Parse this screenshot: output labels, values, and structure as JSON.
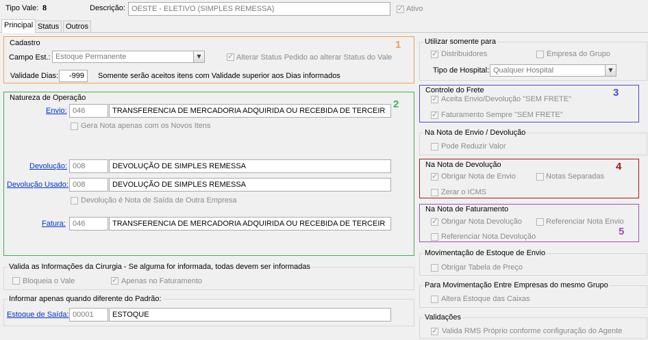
{
  "header": {
    "tipo_vale_label": "Tipo Vale:",
    "tipo_vale_value": "8",
    "descricao_label": "Descrição:",
    "descricao_value": "OESTE - ELETIVO (SIMPLES REMESSA)",
    "ativo_label": "Ativo"
  },
  "tabs": [
    {
      "label": "Principal"
    },
    {
      "label": "Status"
    },
    {
      "label": "Outros"
    }
  ],
  "cadastro": {
    "title": "Cadastro",
    "campo_est_label": "Campo Est.:",
    "campo_est_value": "Estoque Permanente",
    "alterar_status_label": "Alterar Status Pedido ao alterar Status do Vale",
    "validade_label": "Validade Dias:",
    "validade_value": "-999",
    "validade_note": "Somente serão aceitos itens com Validade superior aos Dias informados",
    "marker": "1"
  },
  "natureza": {
    "title": "Natureza de Operação",
    "marker": "2",
    "envio_label": "Envio:",
    "envio_code": "046",
    "envio_desc": "TRANSFERENCIA DE MERCADORIA ADQUIRIDA OU RECEBIDA DE TERCEIR",
    "gera_nota_label": "Gera Nota apenas com os Novos Itens",
    "devolucao_label": "Devolução:",
    "devolucao_code": "008",
    "devolucao_desc": "DEVOLUÇÃO DE SIMPLES REMESSA",
    "devolucao_usado_label": "Devolução Usado:",
    "devolucao_usado_code": "008",
    "devolucao_usado_desc": "DEVOLUÇÃO DE SIMPLES REMESSA",
    "devolucao_saida_label": "Devolução é Nota de Saída de Outra Empresa",
    "fatura_label": "Fatura:",
    "fatura_code": "046",
    "fatura_desc": "TRANSFERENCIA DE MERCADORIA ADQUIRIDA OU RECEBIDA DE TERCEIR"
  },
  "cirurgia": {
    "title": "Valida as Informações da Cirurgia - Se alguma for informada, todas devem ser informadas",
    "bloqueia_label": "Bloqueia o Vale",
    "apenas_faturamento_label": "Apenas no Faturamento"
  },
  "padrao": {
    "title": "Informar apenas quando diferente do Padrão:",
    "estoque_saida_label": "Estoque de Saída:",
    "estoque_saida_code": "00001",
    "estoque_saida_desc": "ESTOQUE"
  },
  "utilizar": {
    "title": "Utilizar somente para",
    "distribuidores_label": "Distribuidores",
    "empresa_grupo_label": "Empresa do Grupo",
    "tipo_hospital_label": "Tipo de Hospital:",
    "tipo_hospital_value": "Qualquer Hospital"
  },
  "frete": {
    "title": "Controle do Frete",
    "marker": "3",
    "aceita_label": "Aceita Envio/Devolução \"SEM FRETE\"",
    "faturamento_label": "Faturamento Sempre \"SEM FRETE\""
  },
  "nota_envio": {
    "title": "Na Nota de Envio / Devolução",
    "pode_reduzir_label": "Pode Reduzir Valor"
  },
  "nota_devolucao": {
    "title": "Na Nota de Devolução",
    "marker": "4",
    "obrigar_envio_label": "Obrigar Nota de Envio",
    "notas_separadas_label": "Notas Separadas",
    "zerar_icms_label": "Zerar o ICMS"
  },
  "nota_faturamento": {
    "title": "Na Nota de Faturamento",
    "marker": "5",
    "obrigar_devolucao_label": "Obrigar Nota Devolução",
    "referenciar_envio_label": "Referenciar Nota Envio",
    "referenciar_devolucao_label": "Referenciar Nota Devolução"
  },
  "mov_estoque": {
    "title": "Movimentação de Estoque de Envio",
    "obrigar_tabela_label": "Obrigar Tabela de Preço"
  },
  "mov_empresas": {
    "title": "Para Movimentação Entre Empresas do mesmo Grupo",
    "altera_caixas_label": "Altera Estoque das Caixas"
  },
  "validacoes": {
    "title": "Validações",
    "valida_rms_label": "Valida RMS Próprio conforme configuração do Agente"
  },
  "colors": {
    "orange": "#f0a050",
    "green": "#3cb050",
    "blue": "#4a4ad0",
    "darkred": "#a01818",
    "purple": "#a050b0",
    "link": "#0033cc"
  }
}
